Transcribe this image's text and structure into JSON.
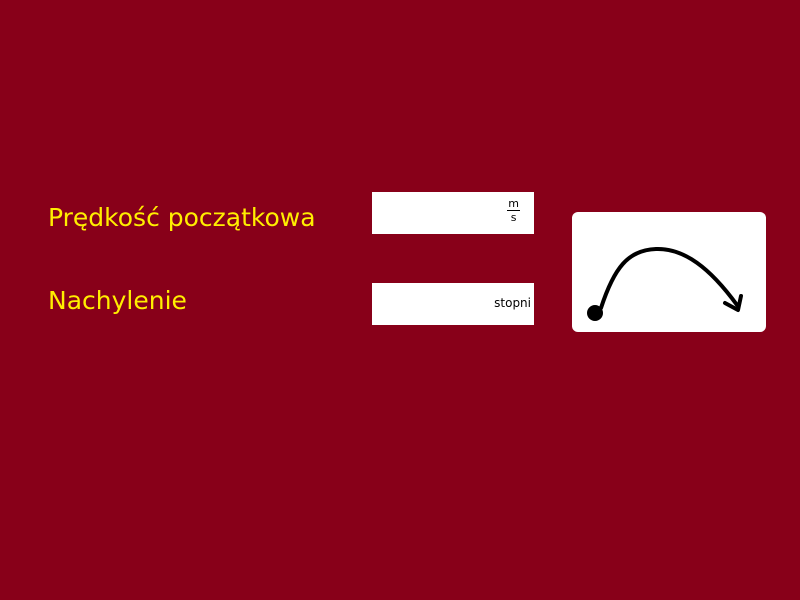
{
  "form": {
    "velocity": {
      "label": "Prędkość początkowa",
      "value": "",
      "unit_numerator": "m",
      "unit_denominator": "s"
    },
    "angle": {
      "label": "Nachylenie",
      "value": "",
      "unit": "stopni"
    }
  },
  "launch_button": {
    "icon": "projectile-arc-icon"
  },
  "colors": {
    "background": "#880019",
    "label": "#ffee00",
    "field": "#ffffff"
  }
}
